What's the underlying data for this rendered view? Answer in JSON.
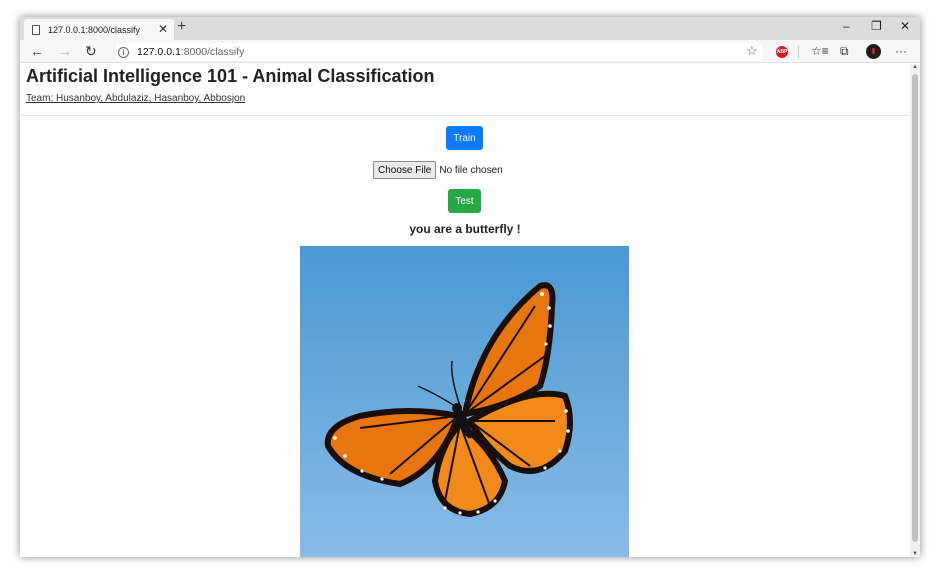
{
  "browser": {
    "tab_title": "127.0.0.1:8000/classify",
    "tab_close": "✕",
    "new_tab": "+",
    "address_host": "127.0.0.1",
    "address_path": ":8000/classify",
    "window_controls": {
      "minimize": "–",
      "restore": "❐",
      "close": "✕"
    },
    "icons": [
      "back-icon",
      "forward-icon",
      "refresh-icon",
      "info-icon",
      "star-icon",
      "adblock-icon",
      "favorites-icon",
      "collections-icon",
      "profile-avatar",
      "more-icon"
    ],
    "abp_label": "ABP"
  },
  "page": {
    "title": "Artificial Intelligence 101 - Animal Classification",
    "team": "Team: Husanboy, Abdulaziz, Hasanboy, Abbosjon",
    "train_button": "Train",
    "choose_file_button": "Choose File",
    "file_status": "No file chosen",
    "test_button": "Test",
    "result_text": "you are a butterfly !"
  },
  "colors": {
    "train_button": "#0d7bff",
    "test_button": "#28a745",
    "sky_top": "#4a98d4",
    "sky_bottom": "#88bbe6",
    "wing_orange": "#e8760f"
  }
}
